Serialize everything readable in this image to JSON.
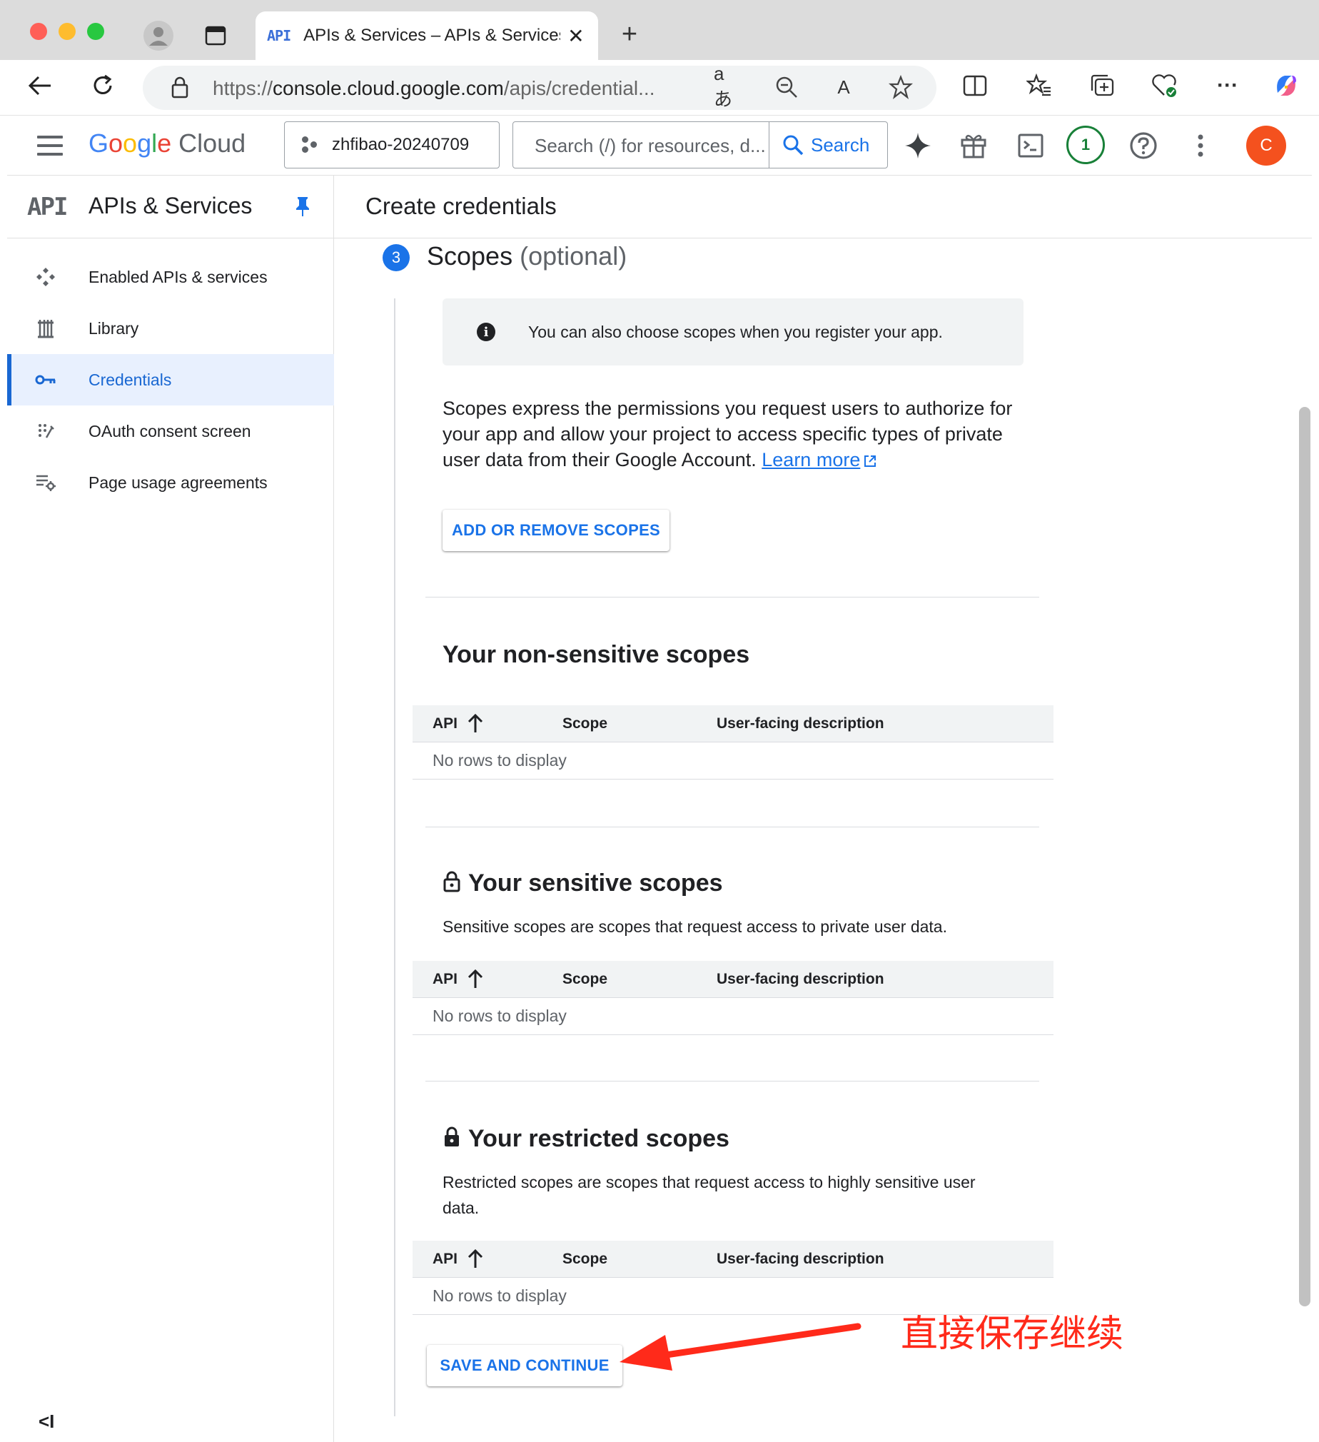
{
  "browser": {
    "tab_api_label": "API",
    "tab_title": "APIs & Services – APIs & Services",
    "tab_close": "✕",
    "new_tab": "+",
    "url_scheme": "https://",
    "url_host": "console.cloud.google.com",
    "url_path": "/apis/credential..."
  },
  "header": {
    "logo_g": "G",
    "logo_o1": "o",
    "logo_o2": "o",
    "logo_g2": "g",
    "logo_l": "l",
    "logo_e": "e",
    "logo_cloud": " Cloud",
    "project": "zhfibao-20240709",
    "search_placeholder": "Search (/) for resources, d...",
    "search_button": "Search",
    "notifications_count": "1",
    "avatar_initial": "C"
  },
  "sidebar": {
    "api_label": "API",
    "title": "APIs & Services",
    "items": [
      {
        "label": "Enabled APIs & services",
        "icon": "apps-icon"
      },
      {
        "label": "Library",
        "icon": "library-icon"
      },
      {
        "label": "Credentials",
        "icon": "key-icon",
        "active": true
      },
      {
        "label": "OAuth consent screen",
        "icon": "oauth-icon"
      },
      {
        "label": "Page usage agreements",
        "icon": "settings-list-icon"
      }
    ],
    "collapse_label": "<I"
  },
  "main": {
    "title": "Create credentials",
    "step_number": "3",
    "step_title": "Scopes",
    "step_optional": "(optional)",
    "info_text": "You can also choose scopes when you register your app.",
    "description": "Scopes express the permissions you request users to authorize for your app and allow your project to access specific types of private user data from their Google Account.",
    "learn_more": "Learn more",
    "add_remove_button": "ADD OR REMOVE SCOPES",
    "sections": [
      {
        "title": "Your non-sensitive scopes",
        "subtitle": "",
        "columns": [
          "API",
          "Scope",
          "User-facing description"
        ],
        "empty": "No rows to display"
      },
      {
        "title": "Your sensitive scopes",
        "subtitle": "Sensitive scopes are scopes that request access to private user data.",
        "columns": [
          "API",
          "Scope",
          "User-facing description"
        ],
        "empty": "No rows to display"
      },
      {
        "title": "Your restricted scopes",
        "subtitle": "Restricted scopes are scopes that request access to highly sensitive user data.",
        "columns": [
          "API",
          "Scope",
          "User-facing description"
        ],
        "empty": "No rows to display"
      }
    ],
    "save_button": "SAVE AND CONTINUE"
  },
  "annotation": {
    "text": "直接保存继续",
    "color": "#ff2a1a"
  },
  "colors": {
    "accent": "#1a73e8",
    "active_nav": "#1967d2",
    "avatar": "#f4511e"
  }
}
